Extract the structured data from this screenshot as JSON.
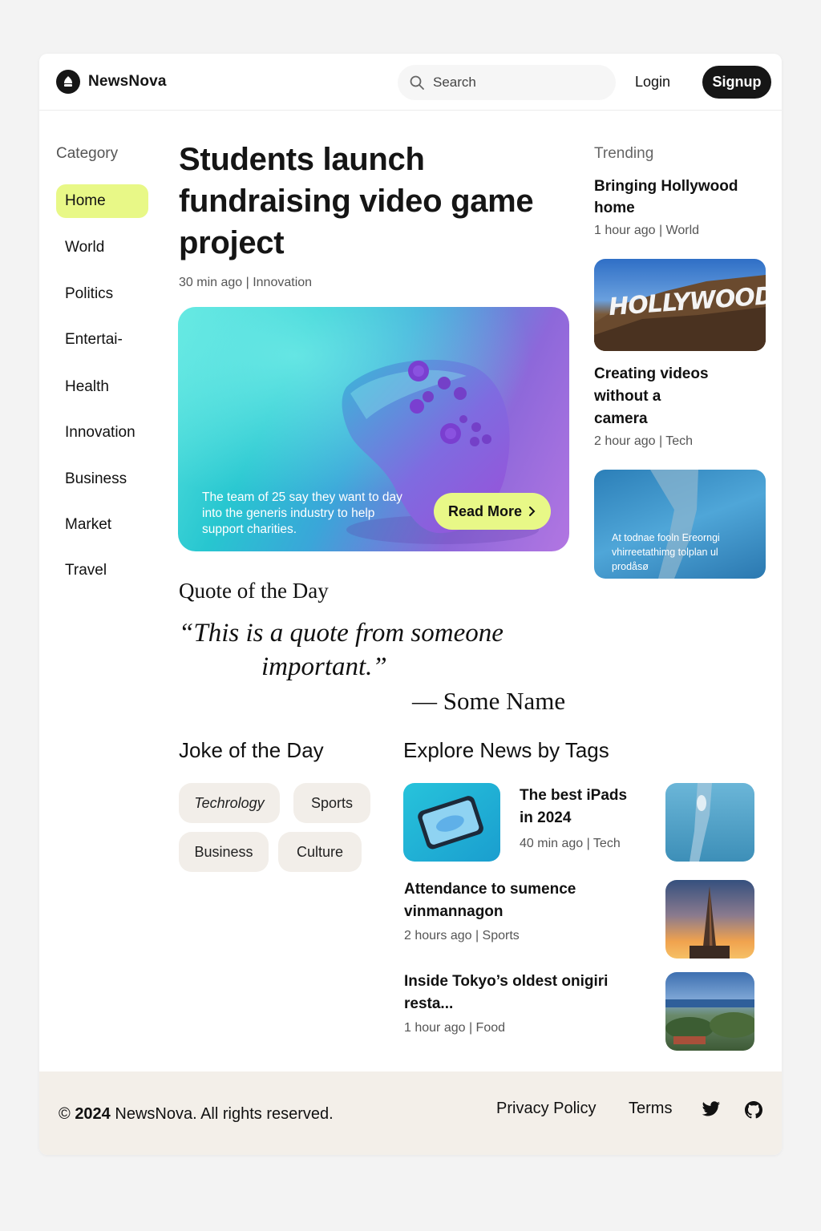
{
  "brand": {
    "name": "NewsNova"
  },
  "header": {
    "search_placeholder": "Search",
    "login_label": "Login",
    "signup_label": "Signup"
  },
  "sidebar": {
    "title": "Category",
    "items": [
      {
        "label": "Home",
        "active": true
      },
      {
        "label": "World"
      },
      {
        "label": "Politics"
      },
      {
        "label": "Entertai-"
      },
      {
        "label": "Health"
      },
      {
        "label": "Innovation"
      },
      {
        "label": "Business"
      },
      {
        "label": "Market"
      },
      {
        "label": "Travel"
      }
    ]
  },
  "main": {
    "headline": "Students launch fundraising video game project",
    "meta": "30 min ago | Innovation",
    "hero_text": "The team of 25 say they want to day into the generis industry to help support charities.",
    "read_more_label": "Read More"
  },
  "quote": {
    "title": "Quote of the Day",
    "line1": "“This is a quote from someone",
    "line2": "important.”",
    "author": "— Some Name"
  },
  "joke": {
    "title": "Joke of the Day",
    "tags": [
      "Techrology",
      "Sports",
      "Business",
      "Culture"
    ]
  },
  "explore": {
    "title": "Explore News by Tags",
    "articles": [
      {
        "title_l1": "The best iPads",
        "title_l2": "in 2024",
        "meta": "40 min ago | Tech"
      },
      {
        "title_l1": "Attendance to sumence",
        "title_l2": "vinmannagon",
        "meta": "2 hours ago | Sports"
      },
      {
        "title_l1": "Inside Tokyo’s oldest onigiri",
        "title_l2": "resta...",
        "meta": "1 hour ago | Food"
      }
    ]
  },
  "trending": {
    "title": "Trending",
    "items": [
      {
        "title_l1": "Bringing Hollywood",
        "title_l2": "home",
        "meta": "1 hour ago | World",
        "image_text": "HOLLYWOOD"
      },
      {
        "title_l1": "Creating videos",
        "title_l2": "without a",
        "title_l3": "camera",
        "meta": "2 hour ago | Tech"
      }
    ],
    "card_caption": [
      "At todnae fooln Ereorngi",
      "vhirreetathimg tolplan ul",
      "prodåsø"
    ]
  },
  "footer": {
    "copyright_symbol": "©",
    "copyright_year": "2024",
    "copyright_rest": "NewsNova. All rights reserved.",
    "privacy_label": "Privacy Policy",
    "terms_label": "Terms"
  },
  "icons": [
    "logo-icon",
    "search-icon",
    "chevron-right-icon",
    "twitter-icon",
    "github-icon"
  ],
  "colors": {
    "accent": "#e8f887",
    "dark": "#161616",
    "footer_bg": "#f3efe9",
    "tag_bg": "#f2eee9"
  }
}
